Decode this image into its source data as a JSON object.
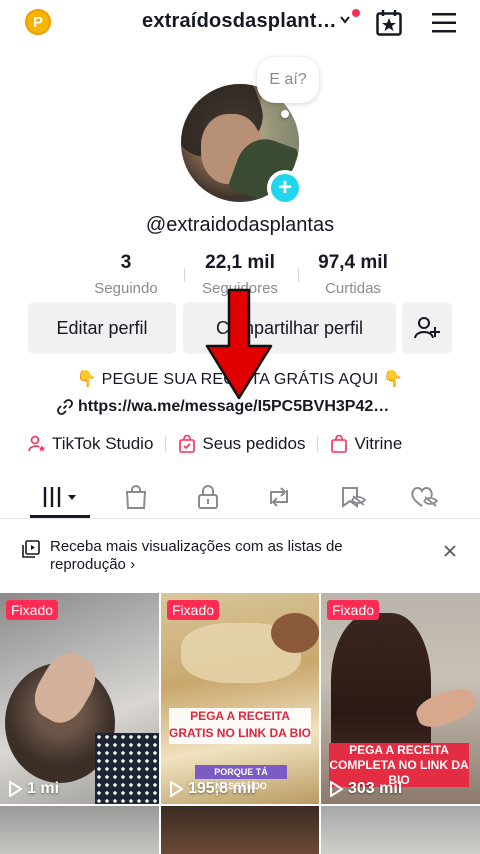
{
  "header": {
    "coin_label": "P",
    "username": "extraídosdasplant…",
    "icons": [
      "coin-icon",
      "chevron-down-icon",
      "calendar-star-icon",
      "hamburger-menu-icon"
    ]
  },
  "profile": {
    "bubble": "E aí?",
    "handle": "@extraidodasplantas",
    "stats": [
      {
        "value": "3",
        "label": "Seguindo"
      },
      {
        "value": "22,1 mil",
        "label": "Seguidores"
      },
      {
        "value": "97,4 mil",
        "label": "Curtidas"
      }
    ],
    "buttons": {
      "edit": "Editar perfil",
      "share": "Compartilhar perfil"
    },
    "bio": "👇 PEGUE SUA RECEITA GRÁTIS AQUI 👇",
    "link": "https://wa.me/message/I5PC5BVH3P42…"
  },
  "shortcuts": [
    {
      "label": "TikTok Studio",
      "icon": "person-star-icon"
    },
    {
      "label": "Seus pedidos",
      "icon": "bag-check-icon"
    },
    {
      "label": "Vitrine",
      "icon": "shopping-bag-icon"
    }
  ],
  "tabs": [
    "grid-icon",
    "shop-bag-icon",
    "lock-icon",
    "repost-icon",
    "eye-slash-icon",
    "heart-slash-icon"
  ],
  "banner": {
    "text": "Receba mais visualizações com as listas de reprodução",
    "chevron": "›"
  },
  "videos": [
    {
      "pinned": "Fixado",
      "views": "1 mi"
    },
    {
      "pinned": "Fixado",
      "views": "195,8 mil",
      "caption": "PEGA A RECEITA GRATIS NO LINK DA BIO",
      "subcaption": "PORQUE TÁ NASCENDO"
    },
    {
      "pinned": "Fixado",
      "views": "303 mil",
      "caption": "PEGA A RECEITA COMPLETA NO LINK DA BIO"
    }
  ],
  "colors": {
    "accent": "#fe2c55",
    "badge": "#20d5ec",
    "arrow": "#e00000",
    "text": "#161823",
    "muted": "#8a8b91"
  }
}
